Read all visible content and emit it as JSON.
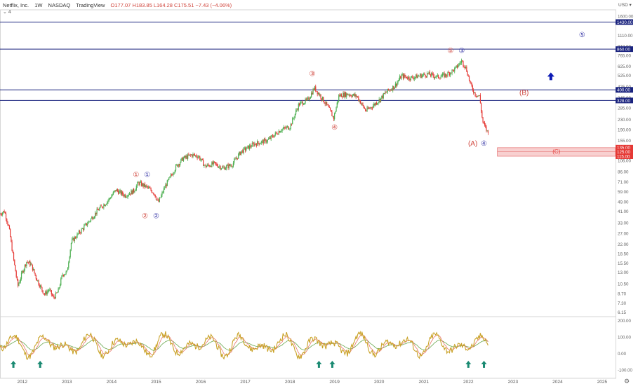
{
  "header": {
    "symbol": "Netflix, Inc.",
    "interval": "1W",
    "exchange": "NASDAQ",
    "source": "TradingView",
    "ohlc": "O177.07 H183.85 L164.28 C175.51 −7.43 (−4.06%)",
    "sub_label": "4",
    "currency": "USD"
  },
  "chart_data": {
    "type": "line",
    "title": "",
    "xlabel": "",
    "ylabel": "",
    "x_ticks": [
      "2012",
      "2013",
      "2014",
      "2015",
      "2016",
      "2017",
      "2018",
      "2019",
      "2020",
      "2021",
      "2022",
      "2023",
      "2024",
      "2025"
    ],
    "y_ticks": [
      6.15,
      7.3,
      8.7,
      10.5,
      13.0,
      15.5,
      18.5,
      22.0,
      27.0,
      33.0,
      41.0,
      49.0,
      59.0,
      71.0,
      86.0,
      106.0,
      155.0,
      190.0,
      230.0,
      285.0,
      345.0,
      425.0,
      525.0,
      625.0,
      765.0,
      910.0,
      1110.0,
      1600.0
    ],
    "y_scale": "log",
    "xlim": [
      2011.5,
      2025.3
    ],
    "ylim": [
      5.8,
      1800
    ],
    "price_series": [
      {
        "x": 2011.5,
        "y": 39
      },
      {
        "x": 2011.6,
        "y": 41
      },
      {
        "x": 2011.7,
        "y": 30
      },
      {
        "x": 2011.8,
        "y": 17
      },
      {
        "x": 2011.9,
        "y": 10
      },
      {
        "x": 2012.0,
        "y": 13
      },
      {
        "x": 2012.1,
        "y": 16
      },
      {
        "x": 2012.2,
        "y": 15
      },
      {
        "x": 2012.3,
        "y": 12
      },
      {
        "x": 2012.4,
        "y": 10
      },
      {
        "x": 2012.5,
        "y": 8.6
      },
      {
        "x": 2012.6,
        "y": 9.4
      },
      {
        "x": 2012.7,
        "y": 8
      },
      {
        "x": 2012.8,
        "y": 9
      },
      {
        "x": 2012.9,
        "y": 12.5
      },
      {
        "x": 2013.0,
        "y": 13
      },
      {
        "x": 2013.1,
        "y": 23
      },
      {
        "x": 2013.3,
        "y": 28
      },
      {
        "x": 2013.5,
        "y": 34
      },
      {
        "x": 2013.7,
        "y": 42
      },
      {
        "x": 2013.9,
        "y": 49
      },
      {
        "x": 2014.1,
        "y": 61
      },
      {
        "x": 2014.3,
        "y": 55
      },
      {
        "x": 2014.5,
        "y": 60
      },
      {
        "x": 2014.6,
        "y": 70
      },
      {
        "x": 2014.8,
        "y": 64
      },
      {
        "x": 2014.95,
        "y": 58
      },
      {
        "x": 2015.05,
        "y": 48
      },
      {
        "x": 2015.2,
        "y": 65
      },
      {
        "x": 2015.45,
        "y": 95
      },
      {
        "x": 2015.6,
        "y": 110
      },
      {
        "x": 2015.8,
        "y": 118
      },
      {
        "x": 2015.95,
        "y": 115
      },
      {
        "x": 2016.1,
        "y": 95
      },
      {
        "x": 2016.3,
        "y": 100
      },
      {
        "x": 2016.5,
        "y": 92
      },
      {
        "x": 2016.7,
        "y": 98
      },
      {
        "x": 2016.9,
        "y": 125
      },
      {
        "x": 2017.2,
        "y": 145
      },
      {
        "x": 2017.5,
        "y": 155
      },
      {
        "x": 2017.8,
        "y": 190
      },
      {
        "x": 2018.0,
        "y": 200
      },
      {
        "x": 2018.2,
        "y": 305
      },
      {
        "x": 2018.4,
        "y": 330
      },
      {
        "x": 2018.55,
        "y": 415
      },
      {
        "x": 2018.7,
        "y": 350
      },
      {
        "x": 2018.85,
        "y": 290
      },
      {
        "x": 2018.98,
        "y": 235
      },
      {
        "x": 2019.1,
        "y": 360
      },
      {
        "x": 2019.3,
        "y": 370
      },
      {
        "x": 2019.5,
        "y": 355
      },
      {
        "x": 2019.7,
        "y": 270
      },
      {
        "x": 2019.85,
        "y": 295
      },
      {
        "x": 2020.0,
        "y": 330
      },
      {
        "x": 2020.15,
        "y": 380
      },
      {
        "x": 2020.35,
        "y": 430
      },
      {
        "x": 2020.5,
        "y": 520
      },
      {
        "x": 2020.7,
        "y": 500
      },
      {
        "x": 2020.9,
        "y": 520
      },
      {
        "x": 2021.1,
        "y": 540
      },
      {
        "x": 2021.3,
        "y": 510
      },
      {
        "x": 2021.5,
        "y": 530
      },
      {
        "x": 2021.7,
        "y": 590
      },
      {
        "x": 2021.85,
        "y": 690
      },
      {
        "x": 2021.95,
        "y": 600
      },
      {
        "x": 2022.05,
        "y": 440
      },
      {
        "x": 2022.15,
        "y": 370
      },
      {
        "x": 2022.25,
        "y": 355
      },
      {
        "x": 2022.32,
        "y": 220
      },
      {
        "x": 2022.4,
        "y": 190
      },
      {
        "x": 2022.45,
        "y": 175
      }
    ],
    "levels": [
      {
        "value": 1430.0,
        "label": "1430.00",
        "color": "#1a237e"
      },
      {
        "value": 860.0,
        "label": "860.00",
        "color": "#1a237e"
      },
      {
        "value": 400.0,
        "label": "400.00",
        "color": "#1a237e"
      },
      {
        "value": 328.0,
        "label": "328.00",
        "color": "#1a237e"
      }
    ],
    "target_zone": {
      "top": 135.0,
      "mid": 125.0,
      "bottom": 115.0,
      "top_label": "135.00",
      "mid_label": "125.00",
      "bottom_label": "115.00",
      "x_start": 2022.65,
      "label": "(C)"
    },
    "wave_labels": [
      {
        "text": "①",
        "x": 2014.55,
        "y": 78,
        "color": "#d0443b"
      },
      {
        "text": "①",
        "x": 2014.8,
        "y": 78,
        "color": "#3a3aa8"
      },
      {
        "text": "②",
        "x": 2014.75,
        "y": 36,
        "color": "#d0443b"
      },
      {
        "text": "②",
        "x": 2015.0,
        "y": 36,
        "color": "#3a3aa8"
      },
      {
        "text": "③",
        "x": 2018.5,
        "y": 520,
        "color": "#d0443b"
      },
      {
        "text": "④",
        "x": 2019.0,
        "y": 190,
        "color": "#d0443b"
      },
      {
        "text": "⑤",
        "x": 2021.6,
        "y": 800,
        "color": "#d0443b"
      },
      {
        "text": "③",
        "x": 2021.85,
        "y": 800,
        "color": "#3a3aa8"
      },
      {
        "text": "(A)",
        "x": 2022.1,
        "y": 140,
        "color": "#d0443b"
      },
      {
        "text": "④",
        "x": 2022.35,
        "y": 140,
        "color": "#3a3aa8"
      },
      {
        "text": "(B)",
        "x": 2023.25,
        "y": 365,
        "color": "#d0443b"
      },
      {
        "text": "⑤",
        "x": 2024.55,
        "y": 1080,
        "color": "#3a3aa8"
      }
    ],
    "arrow_up": {
      "x": 2023.85,
      "y": 520,
      "color": "#0d1bb5"
    },
    "oscillator": {
      "y_ticks": [
        200.0,
        100.0,
        0.0,
        -100.0
      ],
      "ylim": [
        -150,
        210
      ],
      "arrows_up_at": [
        2011.8,
        2012.4,
        2018.65,
        2018.95,
        2022.0,
        2022.35
      ],
      "arrow_color": "#1a8a72",
      "osc_color": "#c9a227",
      "signal_color": "#e8776c",
      "base_color": "#6aa84f"
    },
    "colors": {
      "up": "#26a69a",
      "down": "#ef5350",
      "price_up": "#4caf50",
      "price_down": "#e53935",
      "level": "#1a237e",
      "zone_fill": "#f8d0d0",
      "zone_label": "#e53935"
    }
  }
}
